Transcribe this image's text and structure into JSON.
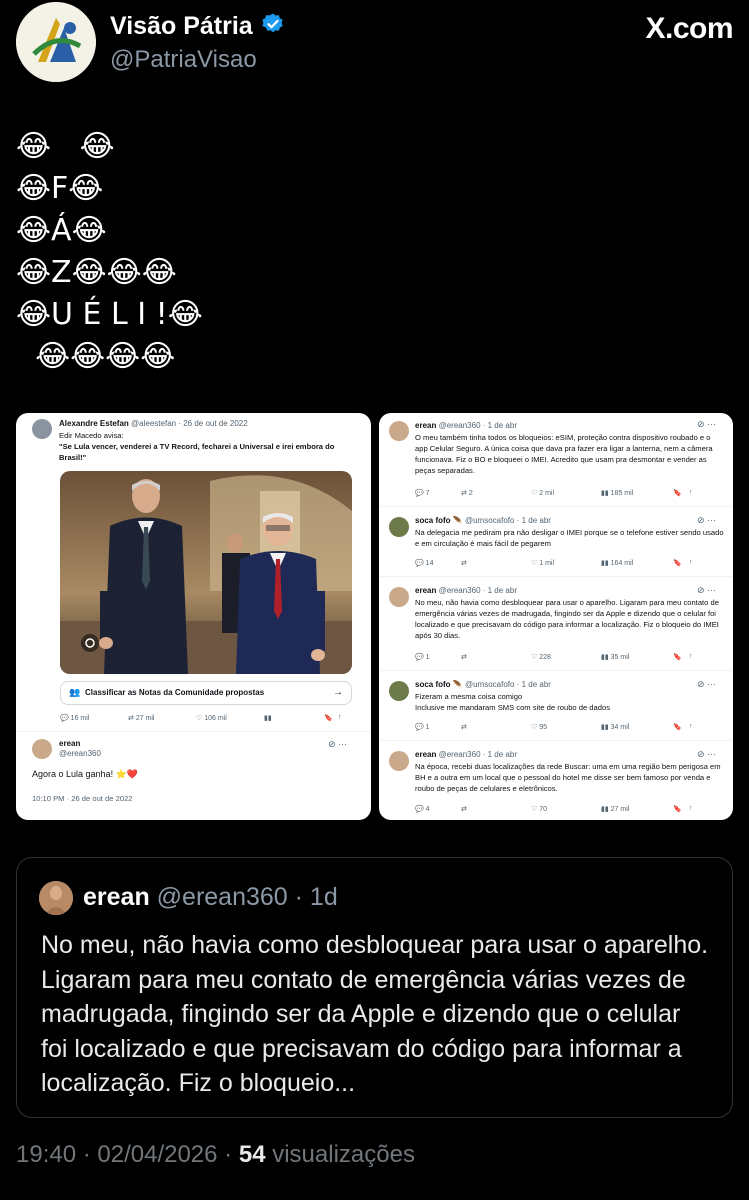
{
  "header": {
    "display_name": "Visão Pátria",
    "handle": "@PatriaVisao",
    "site": "X.com"
  },
  "tweet": {
    "lines": [
      "😂   😂",
      "😂F😂",
      "😂Á😂",
      "😂Z😂😂😂",
      "😂U É L I !😂",
      "  😂😂😂😂"
    ]
  },
  "left_panel": {
    "author_name": "Alexandre Estefan",
    "author_meta": "@aleestefan · 26 de out de 2022",
    "text_1": "Edir Macedo avisa:",
    "text_2": "\"Se Lula vencer, venderei a TV Record, fecharei a Universal e irei embora do Brasil!\"",
    "notes_label": "Classificar as Notas da Comunidade propostas",
    "counts": {
      "replies": "16 mil",
      "reposts": "27 mil",
      "likes": "106 mil"
    },
    "reply_name": "erean",
    "reply_handle": "@erean360",
    "reply_text": "Agora o Lula ganha! ⭐❤️",
    "reply_time": "10:10 PM · 26 de out de 2022"
  },
  "right_panel": {
    "posts": [
      {
        "name": "erean",
        "meta": "@erean360 · 1 de abr",
        "text": "O meu também tinha todos os bloqueios: eSIM, proteção contra dispositivo roubado e o app Celular Seguro. A única coisa que dava pra fazer era ligar a lanterna, nem a câmera funcionava. Fiz o BO e bloqueei o IMEI. Acredito que usam pra desmontar e vender as peças separadas.",
        "replies": "7",
        "reposts": "2",
        "likes": "2 mil",
        "views": "185 mil"
      },
      {
        "name": "soca fofo 🪶",
        "meta": "@umsocafofo · 1 de abr",
        "text": "Na delegacia me pediram pra não desligar o IMEI porque se o telefone estiver sendo usado e em circulação é mais fácil de pegarem",
        "replies": "14",
        "reposts": "",
        "likes": "1 mil",
        "views": "164 mil"
      },
      {
        "name": "erean",
        "meta": "@erean360 · 1 de abr",
        "text": "No meu, não havia como desbloquear para usar o aparelho. Ligaram para meu contato de emergência várias vezes de madrugada, fingindo ser da Apple e dizendo que o celular foi localizado e que precisavam do código para informar a localização. Fiz o bloqueio do IMEI após 30 dias.",
        "replies": "1",
        "reposts": "",
        "likes": "228",
        "views": "35 mil"
      },
      {
        "name": "soca fofo 🪶",
        "meta": "@umsocafofo · 1 de abr",
        "text": "Fizeram a mesma coisa comigo\nInclusive me mandaram SMS com site de roubo de dados",
        "replies": "1",
        "reposts": "",
        "likes": "95",
        "views": "34 mil"
      },
      {
        "name": "erean",
        "meta": "@erean360 · 1 de abr",
        "text": "Na época, recebi duas localizações da rede Buscar: uma em uma região bem perigosa em BH e a outra em um local que o pessoal do hotel me disse ser bem famoso por venda e roubo de peças de celulares e eletrônicos.",
        "replies": "4",
        "reposts": "",
        "likes": "70",
        "views": "27 mil"
      }
    ]
  },
  "quote": {
    "name": "erean",
    "handle": "@erean360",
    "time": "· 1d",
    "text": "No meu, não havia como desbloquear para usar o aparelho. Ligaram para meu contato de emergência várias vezes de madrugada, fingindo ser da Apple e dizendo que o celular foi localizado e que precisavam do código para informar a localização. Fiz o bloqueio..."
  },
  "footer": {
    "time_date": "19:40 · 02/04/2026 · ",
    "views_count": "54",
    "views_label": " visualizações"
  },
  "colors": {
    "verified": "#1d9bf0",
    "background": "#000000",
    "muted": "#71767b"
  }
}
